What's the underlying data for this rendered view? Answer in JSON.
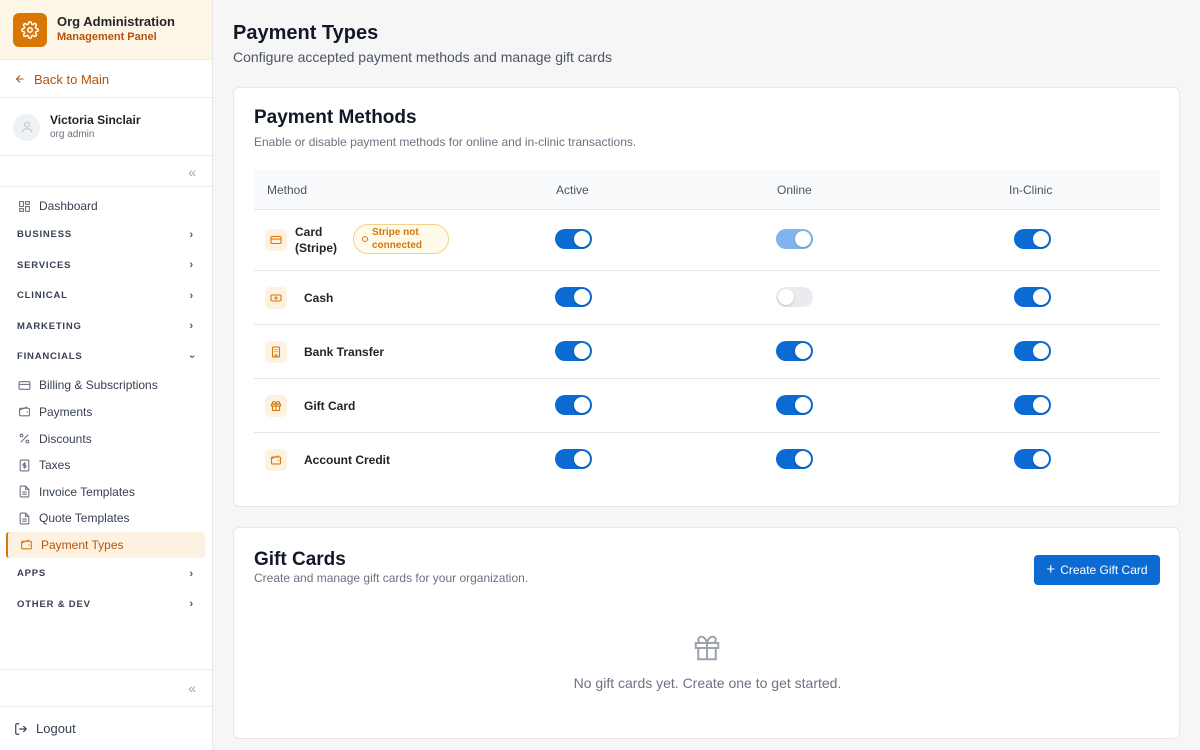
{
  "org": {
    "title": "Org Administration",
    "subtitle": "Management Panel",
    "icon": "gear-icon",
    "accent": "#d97706"
  },
  "back_link": {
    "label": "Back to Main"
  },
  "user": {
    "name": "Victoria Sinclair",
    "role": "org admin"
  },
  "nav": {
    "dashboard": "Dashboard",
    "sections": {
      "business": "BUSINESS",
      "services": "SERVICES",
      "clinical": "CLINICAL",
      "marketing": "MARKETING",
      "financials": "FINANCIALS",
      "apps": "APPS",
      "other": "OTHER & DEV"
    },
    "financials_items": [
      "Billing & Subscriptions",
      "Payments",
      "Discounts",
      "Taxes",
      "Invoice Templates",
      "Quote Templates",
      "Payment Types"
    ]
  },
  "logout": "Logout",
  "page": {
    "title": "Payment Types",
    "subtitle": "Configure accepted payment methods and manage gift cards"
  },
  "payment_methods": {
    "title": "Payment Methods",
    "subtitle": "Enable or disable payment methods for online and in-clinic transactions.",
    "columns": [
      "Method",
      "Active",
      "Online",
      "In-Clinic"
    ],
    "rows": [
      {
        "name_line1": "Card",
        "name_line2": "(Stripe)",
        "badge_line1": "Stripe not",
        "badge_line2": "connected",
        "active": true,
        "online": "on-disabled",
        "in_clinic": true
      },
      {
        "name": "Cash",
        "active": true,
        "online": false,
        "in_clinic": true
      },
      {
        "name": "Bank Transfer",
        "active": true,
        "online": true,
        "in_clinic": true
      },
      {
        "name": "Gift Card",
        "active": true,
        "online": true,
        "in_clinic": true
      },
      {
        "name": "Account Credit",
        "active": true,
        "online": true,
        "in_clinic": true
      }
    ]
  },
  "gift_cards": {
    "title": "Gift Cards",
    "subtitle": "Create and manage gift cards for your organization.",
    "create_button": "Create Gift Card",
    "empty_text": "No gift cards yet. Create one to get started."
  },
  "colors": {
    "primary": "#0b6bd3",
    "accent": "#d97706"
  }
}
